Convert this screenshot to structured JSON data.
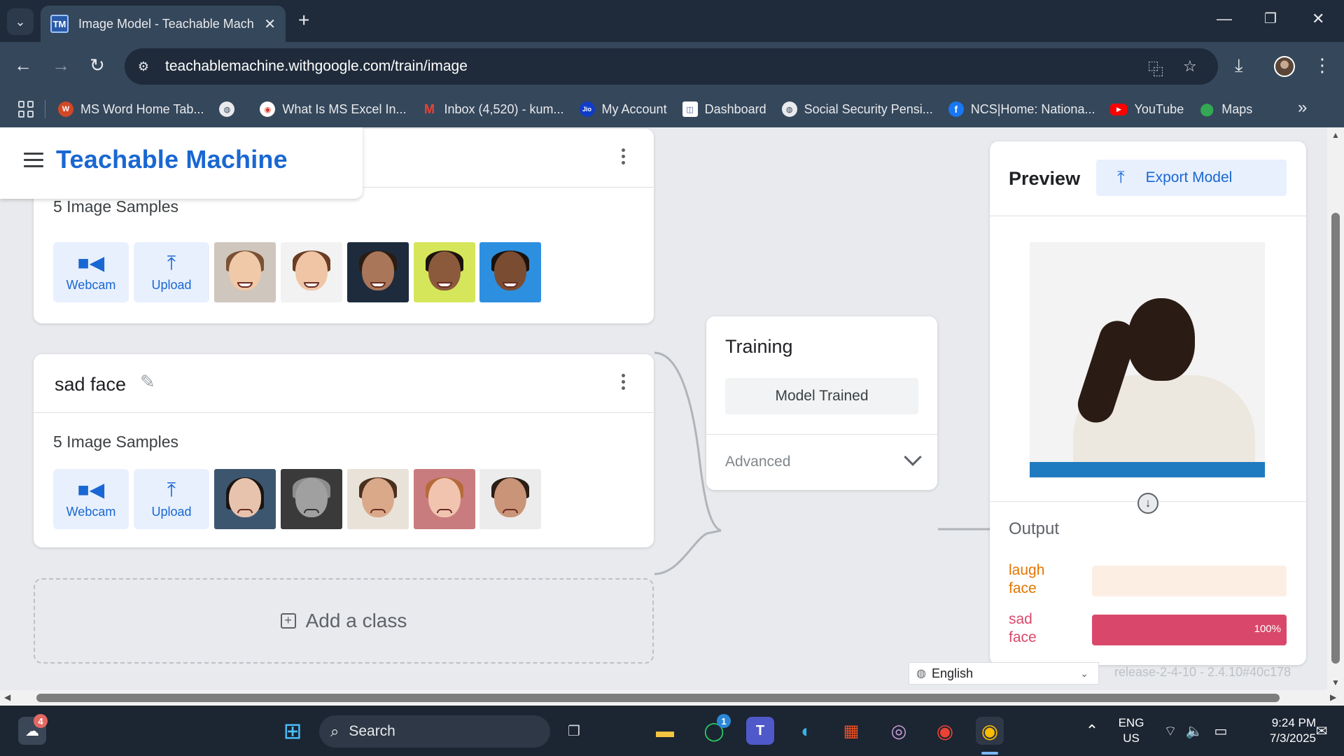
{
  "browser": {
    "tab_title": "Image Model - Teachable Mach",
    "tab_favicon_text": "TM",
    "url": "teachablemachine.withgoogle.com/train/image"
  },
  "bookmarks": [
    {
      "label": "MS Word Home Tab...",
      "icon": "ms-word-favicon",
      "color": "#d24726"
    },
    {
      "label": "What Is MS Excel In...",
      "icon": "excel-favicon",
      "color": "#d93025"
    },
    {
      "label": "Inbox (4,520) - kum...",
      "icon": "gmail-icon",
      "color": "#ea4335"
    },
    {
      "label": "My Account",
      "icon": "jio-icon",
      "color": "#0f3cc9"
    },
    {
      "label": "Dashboard",
      "icon": "dashboard-icon",
      "color": "#3c5a9a"
    },
    {
      "label": "Social Security Pensi...",
      "icon": "globe-icon",
      "color": "#5f6368"
    },
    {
      "label": "NCS|Home: Nationa...",
      "icon": "facebook-icon",
      "color": "#1877f2"
    },
    {
      "label": "YouTube",
      "icon": "youtube-icon",
      "color": "#ff0000"
    },
    {
      "label": "Maps",
      "icon": "maps-icon",
      "color": "#34a853"
    }
  ],
  "app": {
    "title": "Teachable Machine"
  },
  "classes": [
    {
      "name": "laugh face",
      "samples_label": "5 Image Samples",
      "webcam_label": "Webcam",
      "upload_label": "Upload"
    },
    {
      "name": "sad face",
      "samples_label": "5 Image Samples",
      "webcam_label": "Webcam",
      "upload_label": "Upload"
    }
  ],
  "add_class_label": "Add a class",
  "training": {
    "title": "Training",
    "button_label": "Model Trained",
    "advanced_label": "Advanced"
  },
  "preview": {
    "title": "Preview",
    "export_label": "Export Model",
    "output_title": "Output",
    "outputs": [
      {
        "label_line1": "laugh",
        "label_line2": "face",
        "value": 0,
        "color": "#e37400",
        "track_color": "#fdeee4"
      },
      {
        "label_line1": "sad",
        "label_line2": "face",
        "value": 1,
        "pct_text": "100%",
        "color": "#d9486a",
        "track_color": "#fce8ec"
      }
    ]
  },
  "footer": {
    "language": "English",
    "release": "release-2-4-10 - 2.4.10#40c178"
  },
  "taskbar": {
    "search_label": "Search",
    "widgets_badge": "4",
    "whatsapp_badge": "1",
    "lang_line1": "ENG",
    "lang_line2": "US",
    "time": "9:24 PM",
    "date": "7/3/2025"
  }
}
